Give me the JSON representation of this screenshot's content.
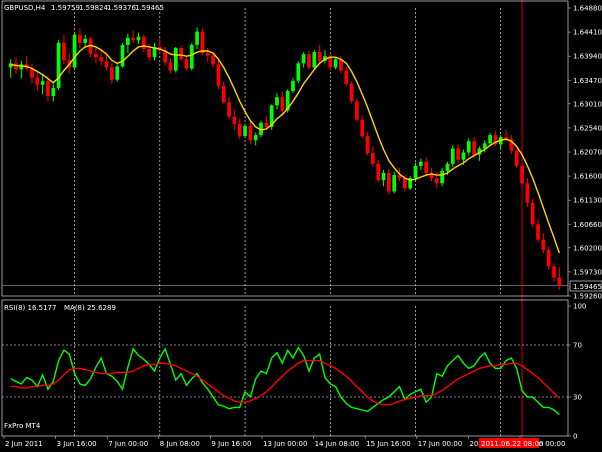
{
  "colors": {
    "background": "#000000",
    "bull": "#00ff00",
    "bear": "#ff0000",
    "ma_main": "#ffd700",
    "rsi": "#00ff00",
    "rsi_ma": "#ff0000",
    "grid": "#ffffff",
    "time_cursor": "#ff0000",
    "label_bg": "#ff0000",
    "frame": "#c0c0c0"
  },
  "header": {
    "symbol": "GBPUSD,H4",
    "open": "1.59759",
    "high": "1.59824",
    "low": "1.59376",
    "close": "1.59465"
  },
  "sub_header": {
    "rsi_label": "RSI(8) 16.5177",
    "ma_label": "MA(8) 25.6289"
  },
  "footer_label": "FxPro MT4",
  "current_price_label": "1.59465",
  "cursor_time_label": "2011.06.22 08:00",
  "chart_data": [
    {
      "type": "candlestick",
      "title": "GBPUSD,H4",
      "ylim": [
        1.5926,
        1.6488
      ],
      "y_ticks": [
        "1.64880",
        "1.64410",
        "1.63940",
        "1.63470",
        "1.63010",
        "1.62540",
        "1.62070",
        "1.61600",
        "1.61130",
        "1.60660",
        "1.60200",
        "1.59730",
        "1.59260"
      ],
      "current_price": 1.59465,
      "candles": [
        [
          1.6372,
          1.6388,
          1.6352,
          1.638
        ],
        [
          1.638,
          1.6392,
          1.636,
          1.6368
        ],
        [
          1.6368,
          1.6385,
          1.635,
          1.6378
        ],
        [
          1.6378,
          1.6395,
          1.6366,
          1.637
        ],
        [
          1.637,
          1.638,
          1.634,
          1.6352
        ],
        [
          1.6352,
          1.6365,
          1.6326,
          1.6338
        ],
        [
          1.6338,
          1.636,
          1.632,
          1.6345
        ],
        [
          1.6345,
          1.6355,
          1.6306,
          1.6316
        ],
        [
          1.6316,
          1.634,
          1.6306,
          1.6332
        ],
        [
          1.6332,
          1.6425,
          1.6328,
          1.642
        ],
        [
          1.642,
          1.6435,
          1.6378,
          1.6386
        ],
        [
          1.6386,
          1.64,
          1.636,
          1.6372
        ],
        [
          1.6372,
          1.644,
          1.6368,
          1.6436
        ],
        [
          1.6436,
          1.6448,
          1.641,
          1.642
        ],
        [
          1.642,
          1.6436,
          1.6412,
          1.6428
        ],
        [
          1.6428,
          1.6432,
          1.6392,
          1.6398
        ],
        [
          1.6398,
          1.641,
          1.638,
          1.6392
        ],
        [
          1.6392,
          1.6406,
          1.6376,
          1.6384
        ],
        [
          1.6384,
          1.6398,
          1.6366,
          1.6372
        ],
        [
          1.6372,
          1.638,
          1.634,
          1.6348
        ],
        [
          1.6348,
          1.6378,
          1.6344,
          1.6374
        ],
        [
          1.6374,
          1.642,
          1.6372,
          1.6416
        ],
        [
          1.6416,
          1.6438,
          1.64,
          1.643
        ],
        [
          1.643,
          1.6444,
          1.642,
          1.6425
        ],
        [
          1.6425,
          1.644,
          1.6418,
          1.6432
        ],
        [
          1.6432,
          1.6436,
          1.6402,
          1.6408
        ],
        [
          1.6408,
          1.6418,
          1.6384,
          1.6392
        ],
        [
          1.6392,
          1.642,
          1.6386,
          1.6412
        ],
        [
          1.6412,
          1.643,
          1.64,
          1.6405
        ],
        [
          1.6405,
          1.6412,
          1.6376,
          1.6382
        ],
        [
          1.6382,
          1.639,
          1.636,
          1.6366
        ],
        [
          1.6366,
          1.6412,
          1.6362,
          1.641
        ],
        [
          1.641,
          1.6415,
          1.6384,
          1.6388
        ],
        [
          1.6388,
          1.6395,
          1.6366,
          1.637
        ],
        [
          1.637,
          1.642,
          1.6366,
          1.6416
        ],
        [
          1.6416,
          1.645,
          1.6408,
          1.6442
        ],
        [
          1.6442,
          1.6448,
          1.6396,
          1.64
        ],
        [
          1.64,
          1.641,
          1.6382,
          1.6395
        ],
        [
          1.6395,
          1.6402,
          1.6372,
          1.6378
        ],
        [
          1.6378,
          1.6385,
          1.633,
          1.6336
        ],
        [
          1.6336,
          1.6345,
          1.63,
          1.6304
        ],
        [
          1.6304,
          1.6315,
          1.6272,
          1.6276
        ],
        [
          1.6276,
          1.629,
          1.625,
          1.6262
        ],
        [
          1.6262,
          1.6272,
          1.6232,
          1.6238
        ],
        [
          1.6238,
          1.6262,
          1.6234,
          1.6258
        ],
        [
          1.6258,
          1.6268,
          1.6222,
          1.623
        ],
        [
          1.623,
          1.6245,
          1.622,
          1.624
        ],
        [
          1.624,
          1.6268,
          1.6236,
          1.6264
        ],
        [
          1.6264,
          1.6278,
          1.625,
          1.6256
        ],
        [
          1.6256,
          1.63,
          1.625,
          1.6298
        ],
        [
          1.6298,
          1.6322,
          1.629,
          1.6314
        ],
        [
          1.6314,
          1.6325,
          1.628,
          1.6288
        ],
        [
          1.6288,
          1.633,
          1.6284,
          1.6326
        ],
        [
          1.6326,
          1.6352,
          1.6322,
          1.6346
        ],
        [
          1.6346,
          1.6384,
          1.6342,
          1.638
        ],
        [
          1.638,
          1.6402,
          1.6372,
          1.6398
        ],
        [
          1.6398,
          1.6405,
          1.6368,
          1.6372
        ],
        [
          1.6372,
          1.6406,
          1.6368,
          1.6402
        ],
        [
          1.6402,
          1.6416,
          1.6378,
          1.6385
        ],
        [
          1.6385,
          1.6406,
          1.638,
          1.6394
        ],
        [
          1.6394,
          1.64,
          1.6366,
          1.6372
        ],
        [
          1.6372,
          1.6392,
          1.6368,
          1.6388
        ],
        [
          1.6388,
          1.6394,
          1.636,
          1.6366
        ],
        [
          1.6366,
          1.6372,
          1.6336,
          1.634
        ],
        [
          1.634,
          1.6345,
          1.6302,
          1.6306
        ],
        [
          1.6306,
          1.6312,
          1.6266,
          1.627
        ],
        [
          1.627,
          1.6278,
          1.6234,
          1.6238
        ],
        [
          1.6238,
          1.6246,
          1.62,
          1.6205
        ],
        [
          1.6205,
          1.6218,
          1.6178,
          1.6184
        ],
        [
          1.6184,
          1.6192,
          1.6148,
          1.6152
        ],
        [
          1.6152,
          1.6172,
          1.614,
          1.6166
        ],
        [
          1.6166,
          1.6174,
          1.6124,
          1.613
        ],
        [
          1.613,
          1.6168,
          1.6126,
          1.6162
        ],
        [
          1.6162,
          1.6176,
          1.615,
          1.6156
        ],
        [
          1.6156,
          1.6162,
          1.613,
          1.6136
        ],
        [
          1.6136,
          1.616,
          1.6132,
          1.6156
        ],
        [
          1.6156,
          1.6186,
          1.615,
          1.618
        ],
        [
          1.618,
          1.6194,
          1.6172,
          1.6188
        ],
        [
          1.6188,
          1.6196,
          1.616,
          1.6166
        ],
        [
          1.6166,
          1.6176,
          1.615,
          1.6156
        ],
        [
          1.6156,
          1.6168,
          1.6136,
          1.6146
        ],
        [
          1.6146,
          1.6176,
          1.614,
          1.617
        ],
        [
          1.617,
          1.6188,
          1.6162,
          1.6184
        ],
        [
          1.6184,
          1.622,
          1.6178,
          1.6214
        ],
        [
          1.6214,
          1.6222,
          1.6186,
          1.6192
        ],
        [
          1.6192,
          1.6212,
          1.6182,
          1.6206
        ],
        [
          1.6206,
          1.6234,
          1.62,
          1.6228
        ],
        [
          1.6228,
          1.6236,
          1.6196,
          1.6202
        ],
        [
          1.6202,
          1.6218,
          1.619,
          1.6214
        ],
        [
          1.6214,
          1.623,
          1.6206,
          1.6224
        ],
        [
          1.6224,
          1.6244,
          1.6218,
          1.624
        ],
        [
          1.624,
          1.6248,
          1.6218,
          1.6222
        ],
        [
          1.6222,
          1.624,
          1.6214,
          1.6236
        ],
        [
          1.6236,
          1.625,
          1.6226,
          1.6232
        ],
        [
          1.6232,
          1.624,
          1.6204,
          1.621
        ],
        [
          1.621,
          1.6218,
          1.6176,
          1.618
        ],
        [
          1.618,
          1.6188,
          1.614,
          1.6146
        ],
        [
          1.6146,
          1.6156,
          1.61,
          1.6108
        ],
        [
          1.6108,
          1.6116,
          1.606,
          1.6066
        ],
        [
          1.6066,
          1.6076,
          1.603,
          1.6036
        ],
        [
          1.6036,
          1.6048,
          1.601,
          1.6016
        ],
        [
          1.6016,
          1.6022,
          1.5978,
          1.5984
        ],
        [
          1.5984,
          1.599,
          1.5954,
          1.5962
        ],
        [
          1.5962,
          1.5982,
          1.5938,
          1.5946
        ]
      ],
      "ma": [
        1.6378,
        1.6376,
        1.6375,
        1.6374,
        1.637,
        1.6364,
        1.6358,
        1.635,
        1.6342,
        1.6352,
        1.6366,
        1.6378,
        1.6392,
        1.6404,
        1.6412,
        1.6415,
        1.6412,
        1.6406,
        1.6398,
        1.6386,
        1.638,
        1.6384,
        1.6394,
        1.6404,
        1.6412,
        1.6414,
        1.6412,
        1.641,
        1.6408,
        1.6404,
        1.6398,
        1.6396,
        1.6396,
        1.6394,
        1.6396,
        1.6402,
        1.6404,
        1.6404,
        1.64,
        1.6388,
        1.6372,
        1.6352,
        1.633,
        1.6306,
        1.6286,
        1.6268,
        1.6256,
        1.625,
        1.6252,
        1.626,
        1.6272,
        1.628,
        1.6292,
        1.6306,
        1.6322,
        1.634,
        1.6354,
        1.6368,
        1.638,
        1.6388,
        1.6392,
        1.6392,
        1.6388,
        1.638,
        1.6364,
        1.6344,
        1.632,
        1.6294,
        1.6266,
        1.6238,
        1.6212,
        1.619,
        1.6176,
        1.6164,
        1.6156,
        1.6152,
        1.6154,
        1.6158,
        1.6162,
        1.6164,
        1.6162,
        1.6162,
        1.6166,
        1.6174,
        1.618,
        1.6186,
        1.6194,
        1.62,
        1.6206,
        1.6212,
        1.622,
        1.6226,
        1.623,
        1.6232,
        1.6228,
        1.6218,
        1.6202,
        1.618,
        1.6156,
        1.6128,
        1.6098,
        1.6068,
        1.604,
        1.601
      ]
    },
    {
      "type": "line",
      "title": "RSI(8) 16.5177",
      "ylim": [
        0,
        100
      ],
      "y_ticks": [
        "100",
        "70",
        "30",
        "0"
      ],
      "levels": [
        70,
        30
      ],
      "x_ticks": [
        "2 Jun 2011",
        "3 Jun 16:00",
        "7 Jun 00:00",
        "8 Jun 08:00",
        "9 Jun 16:00",
        "13 Jun 00:00",
        "14 Jun 08:00",
        "15 Jun 16:00",
        "17 Jun 00:00",
        "20 Jun 08:00",
        "22 Jun 00:00"
      ],
      "series": [
        {
          "name": "RSI(8) 16.5177",
          "values": [
            44,
            42,
            40,
            45,
            43,
            38,
            47,
            36,
            42,
            58,
            66,
            63,
            48,
            40,
            39,
            44,
            53,
            60,
            48,
            46,
            42,
            36,
            53,
            67,
            62,
            59,
            55,
            50,
            60,
            67,
            55,
            43,
            48,
            39,
            44,
            48,
            41,
            36,
            30,
            24,
            23,
            21,
            22,
            22,
            34,
            30,
            44,
            50,
            48,
            60,
            64,
            56,
            66,
            60,
            68,
            62,
            50,
            60,
            63,
            45,
            40,
            38,
            30,
            25,
            22,
            21,
            20,
            19,
            22,
            25,
            28,
            30,
            34,
            38,
            28,
            32,
            34,
            36,
            26,
            30,
            48,
            46,
            54,
            58,
            62,
            56,
            52,
            54,
            60,
            64,
            56,
            52,
            52,
            58,
            60,
            52,
            35,
            30,
            30,
            26,
            22,
            22,
            20,
            16.5
          ]
        },
        {
          "name": "MA(8) 25.6289",
          "values": [
            38,
            38,
            37,
            37,
            38,
            38,
            39,
            39,
            40,
            43,
            47,
            51,
            52,
            52,
            51,
            50,
            49,
            48,
            48,
            48,
            49,
            49,
            49,
            50,
            52,
            54,
            55,
            55,
            56,
            56,
            55,
            54,
            52,
            50,
            48,
            46,
            43,
            40,
            37,
            34,
            31,
            29,
            27,
            26,
            26,
            27,
            29,
            31,
            34,
            38,
            42,
            46,
            50,
            53,
            56,
            58,
            58,
            58,
            58,
            56,
            54,
            52,
            49,
            46,
            42,
            38,
            34,
            30,
            27,
            25,
            24,
            24,
            25,
            27,
            28,
            29,
            30,
            31,
            31,
            31,
            33,
            35,
            38,
            41,
            44,
            46,
            48,
            50,
            52,
            53,
            54,
            54,
            55,
            55,
            56,
            56,
            54,
            51,
            48,
            45,
            41,
            37,
            33,
            29
          ]
        }
      ]
    }
  ]
}
